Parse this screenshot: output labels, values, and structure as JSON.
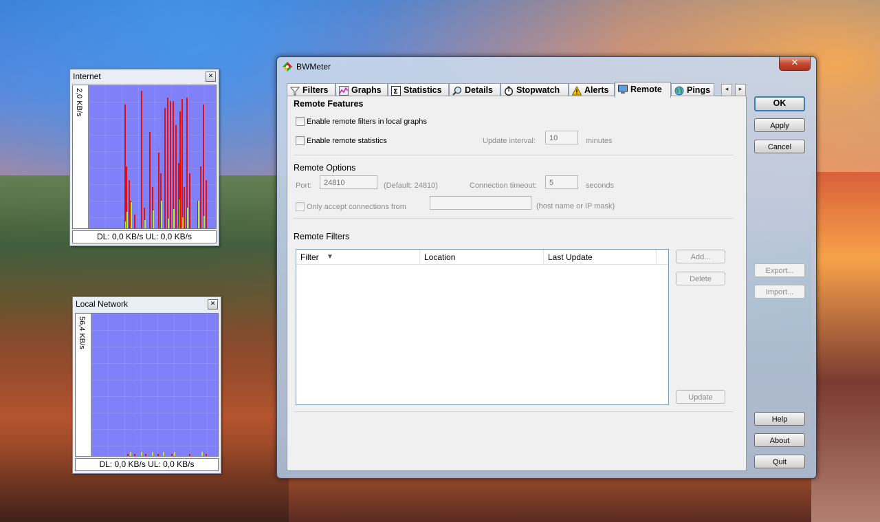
{
  "internet_graph": {
    "title": "Internet",
    "axis_label": "2,0 KB/s",
    "status": "DL: 0,0 KB/s   UL: 0,0 KB/s"
  },
  "local_graph": {
    "title": "Local Network",
    "axis_label": "56,4 KB/s",
    "status": "DL: 0,0 KB/s   UL: 0,0 KB/s"
  },
  "window": {
    "title": "BWMeter",
    "close_glyph": "✕"
  },
  "tabs": [
    {
      "label": "Filters",
      "icon": "filter-icon"
    },
    {
      "label": "Graphs",
      "icon": "graph-icon"
    },
    {
      "label": "Statistics",
      "icon": "sigma-icon"
    },
    {
      "label": "Details",
      "icon": "magnifier-icon"
    },
    {
      "label": "Stopwatch",
      "icon": "stopwatch-icon"
    },
    {
      "label": "Alerts",
      "icon": "warning-icon"
    },
    {
      "label": "Remote",
      "icon": "monitor-icon",
      "active": true
    },
    {
      "label": "Pings",
      "icon": "globe-icon"
    }
  ],
  "remote_features": {
    "title": "Remote Features",
    "enable_remote_filters": "Enable remote filters in local graphs",
    "enable_remote_statistics": "Enable remote statistics",
    "update_interval_label": "Update interval:",
    "update_interval_value": "10",
    "update_interval_unit": "minutes"
  },
  "remote_options": {
    "title": "Remote Options",
    "port_label": "Port:",
    "port_value": "24810",
    "port_default": "(Default: 24810)",
    "timeout_label": "Connection timeout:",
    "timeout_value": "5",
    "timeout_unit": "seconds",
    "only_accept_label": "Only accept connections from",
    "only_accept_value": "",
    "only_accept_hint": "(host name or IP mask)"
  },
  "remote_filters": {
    "title": "Remote Filters",
    "columns": [
      "Filter",
      "Location",
      "Last Update"
    ],
    "add": "Add...",
    "delete": "Delete",
    "update": "Update"
  },
  "side_buttons": {
    "ok": "OK",
    "apply": "Apply",
    "cancel": "Cancel",
    "export": "Export...",
    "import": "Import...",
    "help": "Help",
    "about": "About",
    "quit": "Quit"
  },
  "colors": {
    "graph_bg": "#8080f8",
    "download_bar": "#e01010",
    "upload_bar": "#c8e81a",
    "accent": "#3c7fb1"
  }
}
